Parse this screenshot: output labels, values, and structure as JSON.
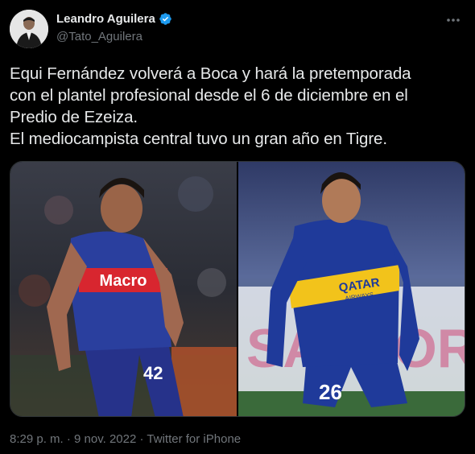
{
  "author": {
    "display_name": "Leandro Aguilera",
    "handle": "@Tato_Aguilera",
    "verified": true
  },
  "tweet": {
    "lines": [
      "Equi Fernández volverá a Boca y hará la pretemporada",
      "con el plantel profesional desde el 6 de diciembre en el",
      "Predio de Ezeiza.",
      "El mediocampista central tuvo un gran año en Tigre."
    ]
  },
  "media": {
    "left_photo": {
      "shirt_sponsor": "Macro",
      "shirt_number": "42"
    },
    "right_photo": {
      "shirt_sponsor_line1": "QATAR",
      "shirt_sponsor_line2": "AIRWAYS",
      "shirt_number": "26",
      "background_text": "SANTOR"
    }
  },
  "footer": {
    "time": "8:29 p. m.",
    "separator": "·",
    "date": "9 nov. 2022",
    "source": "Twitter for iPhone"
  },
  "colors": {
    "background": "#000000",
    "text": "#e7e9ea",
    "secondary": "#71767b",
    "verified": "#1d9bf0",
    "boca_blue": "#1f3a9a",
    "boca_yellow": "#f2c31b",
    "tigre_blue": "#2a3f9e",
    "tigre_red": "#d8262f"
  },
  "icons": {
    "verified": "verified-badge-icon",
    "more": "more-options-icon"
  }
}
